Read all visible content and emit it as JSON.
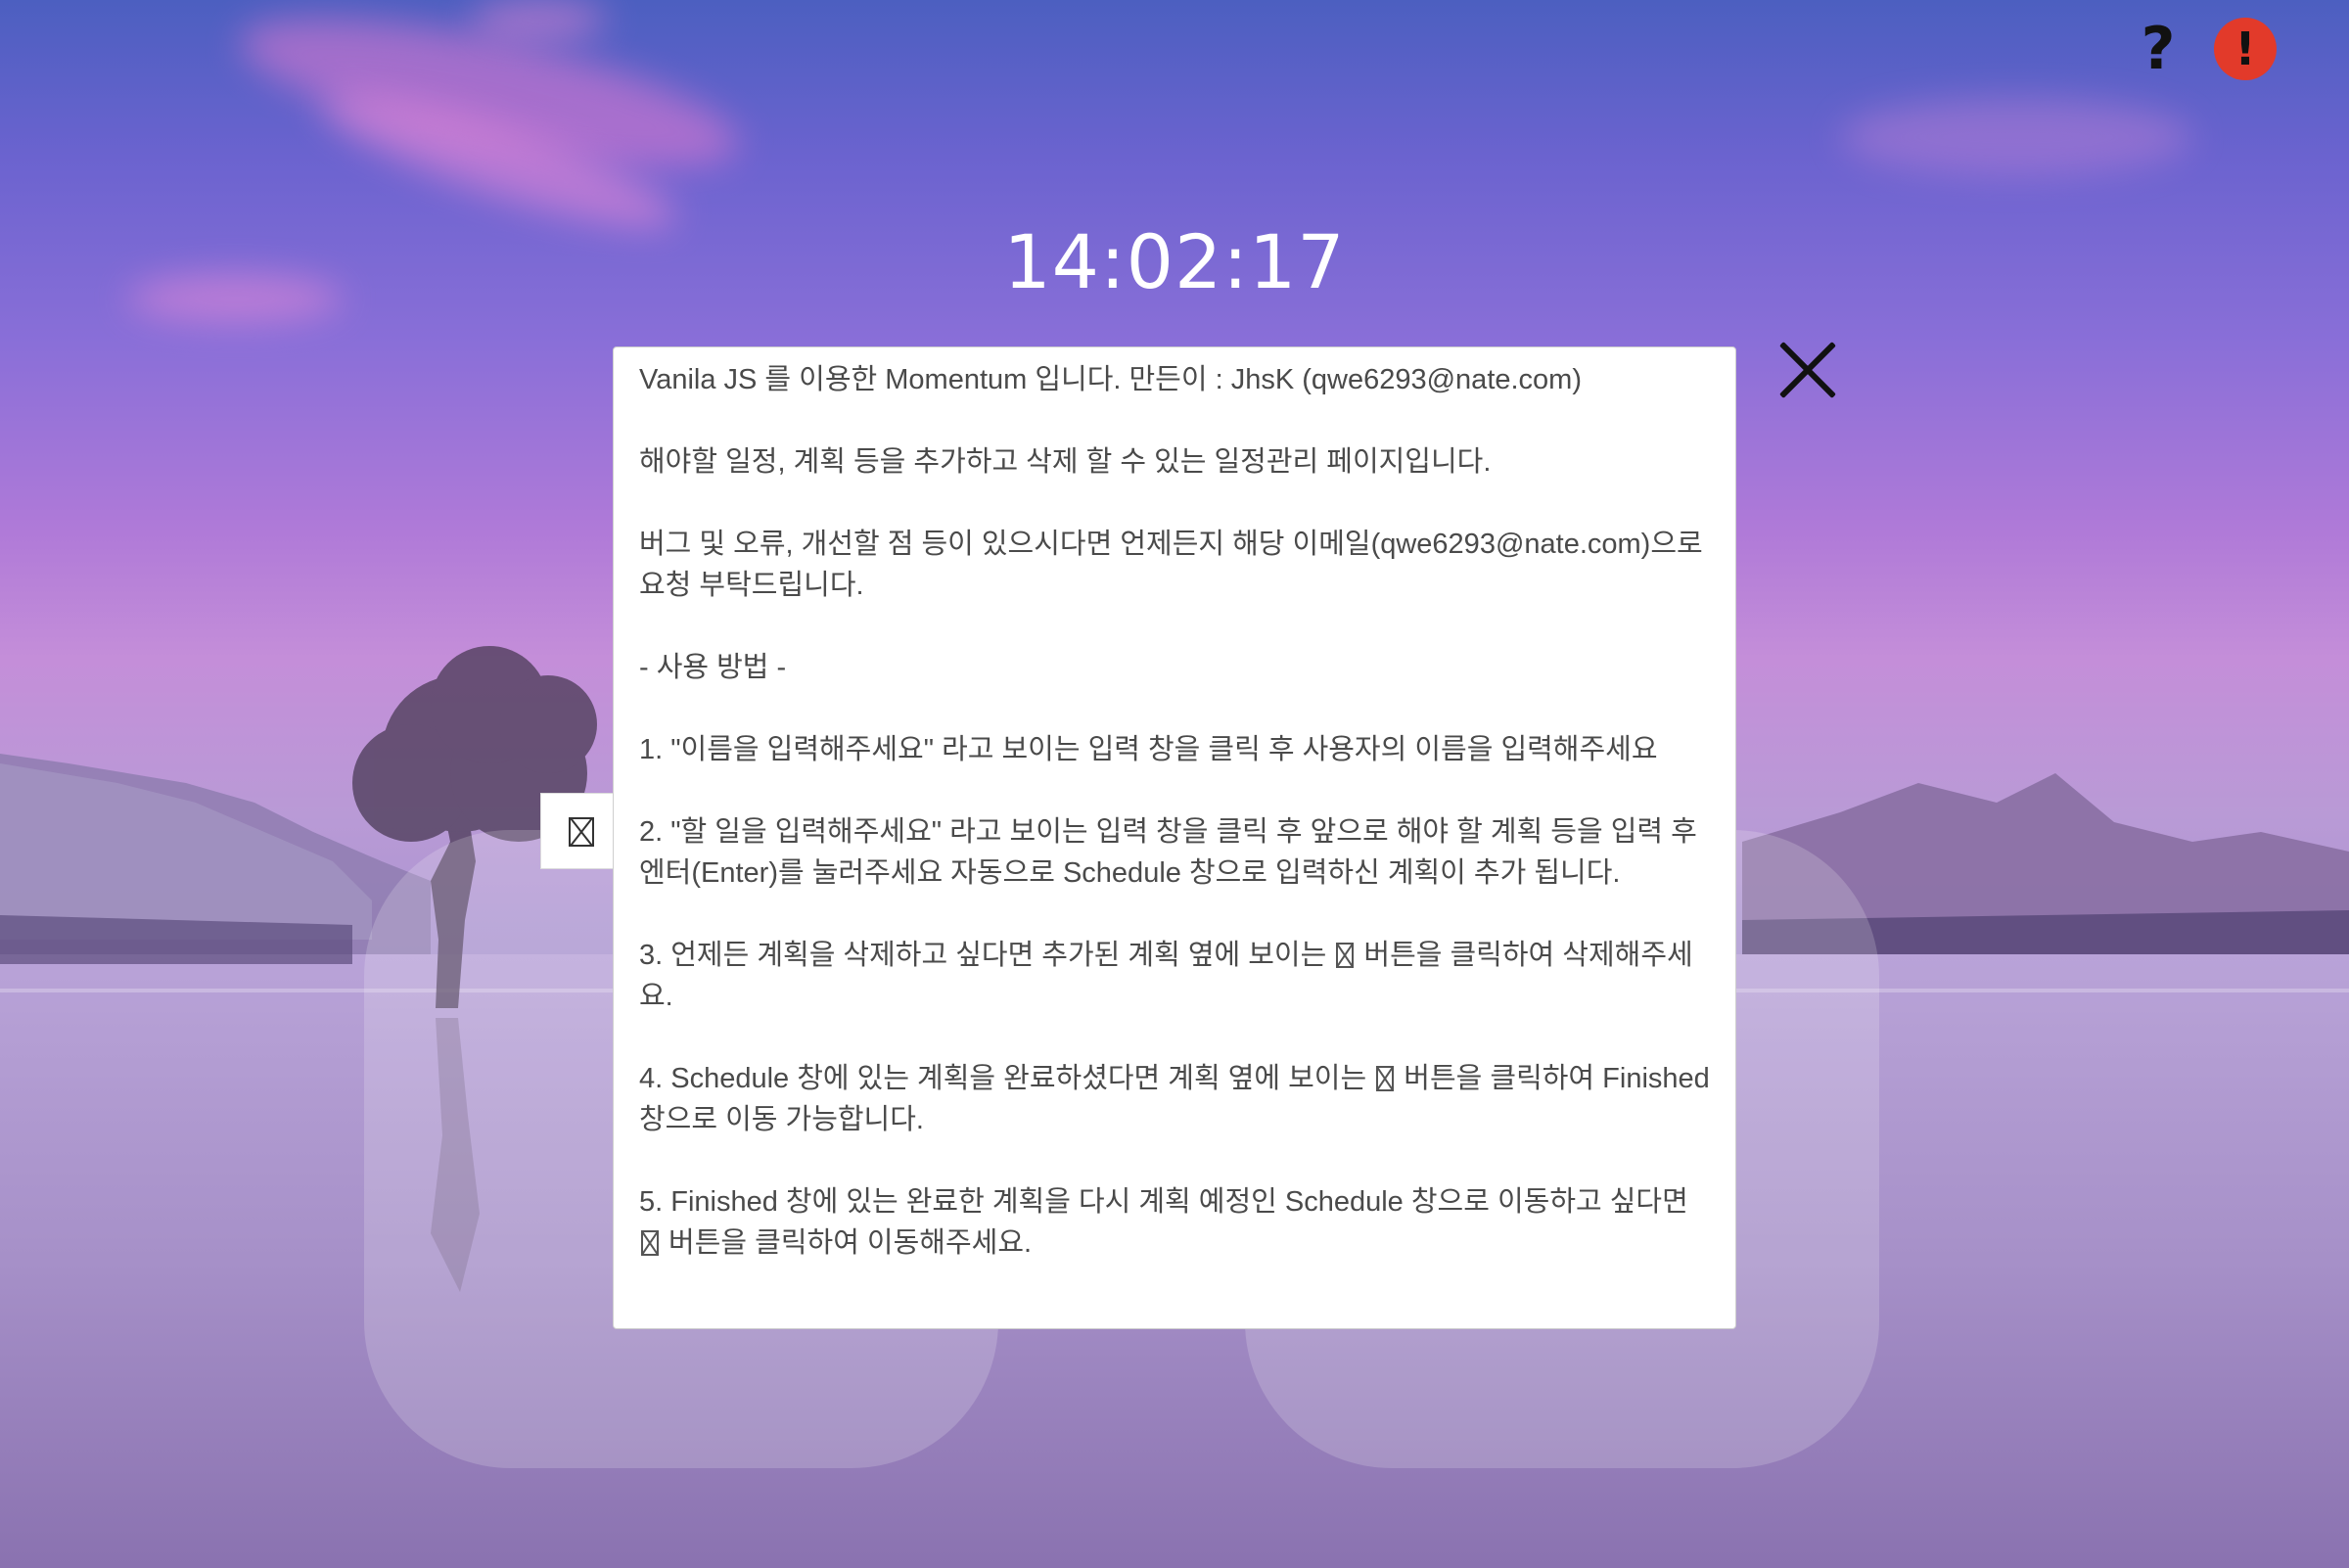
{
  "header": {
    "help_icon": "question-mark-icon",
    "help_glyph": "?",
    "alert_icon": "exclamation-icon",
    "alert_glyph": "!",
    "alert_color": "#e23a2a"
  },
  "clock": {
    "time": "14:02:17"
  },
  "info_modal": {
    "close_icon": "close-icon",
    "paragraphs": [
      "Vanila JS 를 이용한 Momentum 입니다.  만든이 : JhsK (qwe6293@nate.com)",
      "해야할 일정, 계획 등을 추가하고 삭제 할 수 있는 일정관리 페이지입니다.",
      "버그 및 오류, 개선할 점 등이 있으시다면 언제든지 해당 이메일(qwe6293@nate.com)으로 요청 부탁드립니다.",
      "- 사용 방법 -",
      "1. \"이름을 입력해주세요\" 라고 보이는 입력 창을 클릭 후 사용자의 이름을 입력해주세요",
      "2. \"할 일을 입력해주세요\" 라고 보이는 입력 창을 클릭 후 앞으로 해야 할 계획 등을 입력 후 엔터(Enter)를 눌러주세요 자동으로 Schedule 창으로 입력하신 계획이 추가 됩니다."
    ],
    "para3_before": "3. 언제든 계획을 삭제하고 싶다면 추가된 계획 옆에 보이는 ",
    "para3_after": " 버튼을 클릭하여 삭제해주세요.",
    "para4_before": "4. Schedule 창에 있는 계획을 완료하셨다면 계획 옆에 보이는 ",
    "para4_after": " 버튼을 클릭하여 Finished 창으로 이동 가능합니다.",
    "para5_before": "5. Finished 창에 있는 완료한 계획을 다시 계획 예정인 Schedule 창으로 이동하고 싶다면 ",
    "para5_after": " 버튼을 클릭하여 이동해주세요."
  },
  "colors": {
    "sky_top": "#4c5fc0",
    "sky_pink": "#c48ed9",
    "modal_bg": "#ffffff",
    "text": "#4a4a4a"
  }
}
